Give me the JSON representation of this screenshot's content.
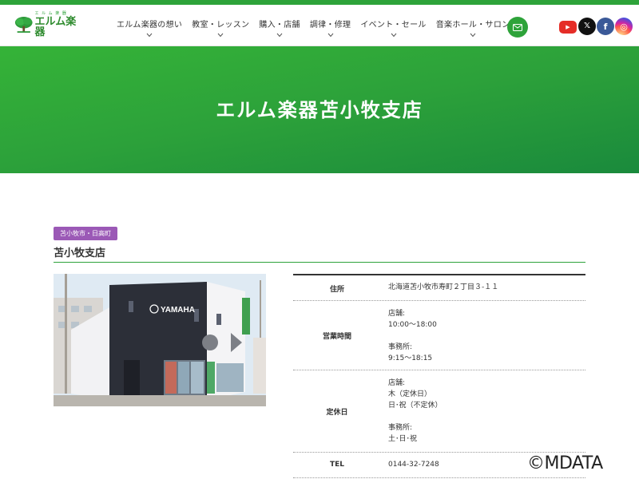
{
  "header": {
    "logo_ruby": "エ ル ム 楽 器",
    "logo_text": "エルム楽器",
    "nav": [
      {
        "label": "エルム楽器の想い"
      },
      {
        "label": "教室・レッスン"
      },
      {
        "label": "購入・店舗"
      },
      {
        "label": "調律・修理"
      },
      {
        "label": "イベント・セール"
      },
      {
        "label": "音楽ホール・サロン"
      }
    ],
    "mail_icon": "mail-icon",
    "social": [
      {
        "name": "youtube",
        "glyph": "▶"
      },
      {
        "name": "x",
        "glyph": "𝕏"
      },
      {
        "name": "facebook",
        "glyph": "f"
      },
      {
        "name": "instagram",
        "glyph": "◎"
      }
    ]
  },
  "hero": {
    "title": "エルム楽器苫小牧支店"
  },
  "store": {
    "badge": "苫小牧市・日高町",
    "title": "苫小牧支店",
    "photo_sign": "YAMAHA",
    "info": {
      "address": {
        "label": "住所",
        "value": "北海道苫小牧市寿町２丁目３-１１"
      },
      "hours": {
        "label": "営業時間",
        "lines": [
          "店舗:",
          "10:00〜18:00",
          "",
          "事務所:",
          "9:15〜18:15"
        ]
      },
      "closed": {
        "label": "定休日",
        "lines": [
          "店舗:",
          "木（定休日）",
          "日･祝（不定休）",
          "",
          "事務所:",
          "土･日･祝"
        ]
      },
      "tel": {
        "label": "TEL",
        "value": "0144-32-7248"
      }
    }
  },
  "watermark": "©MDATA",
  "colors": {
    "brand_green": "#2ea33a",
    "badge_purple": "#9b59b6"
  }
}
